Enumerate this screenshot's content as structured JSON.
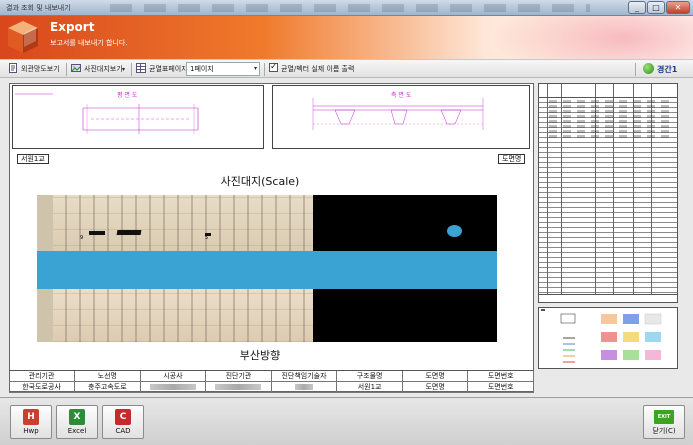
{
  "window": {
    "title": "결과 조회 및 내보내기",
    "minimize": "_",
    "maximize": "□",
    "close": "✕"
  },
  "banner": {
    "title": "Export",
    "subtitle": "보고서를 내보내기 합니다."
  },
  "toolbar": {
    "overview": "외관망도보기",
    "photo_view": "사진대지보기",
    "dropdown_arrow": "▾",
    "crack_page_label": "균열표페이지",
    "crack_page_value": "1페이지",
    "checkbox_label": "균열/벡터 실제 이름 출력",
    "user_name": "경간1"
  },
  "document": {
    "plan_caption": "평 면 도",
    "front_caption": "측 면 도",
    "tag_left": "서원1교",
    "tag_right": "도면명",
    "photo_title": "사진대지(Scale)",
    "direction": "부산방향",
    "marker_9": "9",
    "marker_5": "5"
  },
  "info_table": {
    "headers": [
      "관리기관",
      "노선명",
      "시공사",
      "진단기관",
      "진단책임기술자",
      "구조물명",
      "도면명",
      "도면번호"
    ],
    "values": [
      "한국도로공사",
      "충주고속도로",
      "",
      "",
      "",
      "서원1교",
      "도면명",
      "도면번호"
    ]
  },
  "bottom": {
    "hwp": "Hwp",
    "excel": "Excel",
    "cad": "CAD",
    "exit_icon": "EXIT",
    "close": "닫기(C)"
  },
  "colors": {
    "accent": "#f07a2c",
    "water": "#3ba3d3",
    "drawing_line": "#c12bd0"
  }
}
